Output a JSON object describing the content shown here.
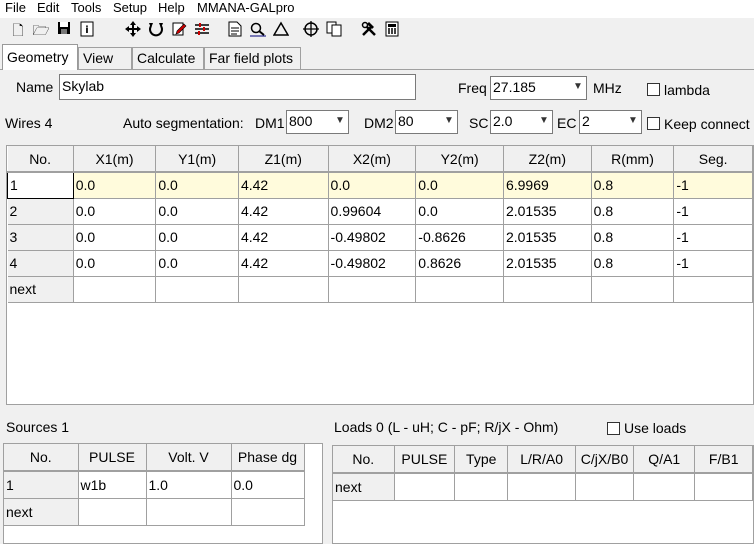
{
  "menu": [
    "File",
    "Edit",
    "Tools",
    "Setup",
    "Help",
    "MMANA-GALpro"
  ],
  "toolbar_icons": [
    "new-file-icon",
    "open-folder-icon",
    "save-icon",
    "info-icon",
    "move-icon",
    "rotate-icon",
    "edit-icon",
    "wire-edit-icon",
    "document-icon",
    "magnify-icon",
    "triangle-icon",
    "crosshair-icon",
    "copy-icon",
    "tools-icon",
    "calculator-icon"
  ],
  "tabs": [
    "Geometry",
    "View",
    "Calculate",
    "Far field plots"
  ],
  "name_label": "Name",
  "name_value": "Skylab",
  "freq_label": "Freq",
  "freq_value": "27.185",
  "freq_unit": "MHz",
  "lambda_label": "lambda",
  "wires_label": "Wires 4",
  "autoseg_label": "Auto segmentation:",
  "dm1_label": "DM1",
  "dm1_value": "800",
  "dm2_label": "DM2",
  "dm2_value": "80",
  "sc_label": "SC",
  "sc_value": "2.0",
  "ec_label": "EC",
  "ec_value": "2",
  "keep_connect_label": "Keep connect",
  "wires_table": {
    "headers": [
      "No.",
      "X1(m)",
      "Y1(m)",
      "Z1(m)",
      "X2(m)",
      "Y2(m)",
      "Z2(m)",
      "R(mm)",
      "Seg."
    ],
    "rows": [
      [
        "1",
        "0.0",
        "0.0",
        "4.42",
        "0.0",
        "0.0",
        "6.9969",
        "0.8",
        "-1"
      ],
      [
        "2",
        "0.0",
        "0.0",
        "4.42",
        "0.99604",
        "0.0",
        "2.01535",
        "0.8",
        "-1"
      ],
      [
        "3",
        "0.0",
        "0.0",
        "4.42",
        "-0.49802",
        "-0.8626",
        "2.01535",
        "0.8",
        "-1"
      ],
      [
        "4",
        "0.0",
        "0.0",
        "4.42",
        "-0.49802",
        "0.8626",
        "2.01535",
        "0.8",
        "-1"
      ]
    ],
    "next_label": "next"
  },
  "sources_label": "Sources 1",
  "sources_table": {
    "headers": [
      "No.",
      "PULSE",
      "Volt. V",
      "Phase dg"
    ],
    "rows": [
      [
        "1",
        "w1b",
        "1.0",
        "0.0"
      ]
    ],
    "next_label": "next"
  },
  "loads_label": "Loads 0 (L - uH; C - pF; R/jX - Ohm)",
  "use_loads_label": "Use loads",
  "loads_table": {
    "headers": [
      "No.",
      "PULSE",
      "Type",
      "L/R/A0",
      "C/jX/B0",
      "Q/A1",
      "F/B1"
    ],
    "next_label": "next"
  }
}
